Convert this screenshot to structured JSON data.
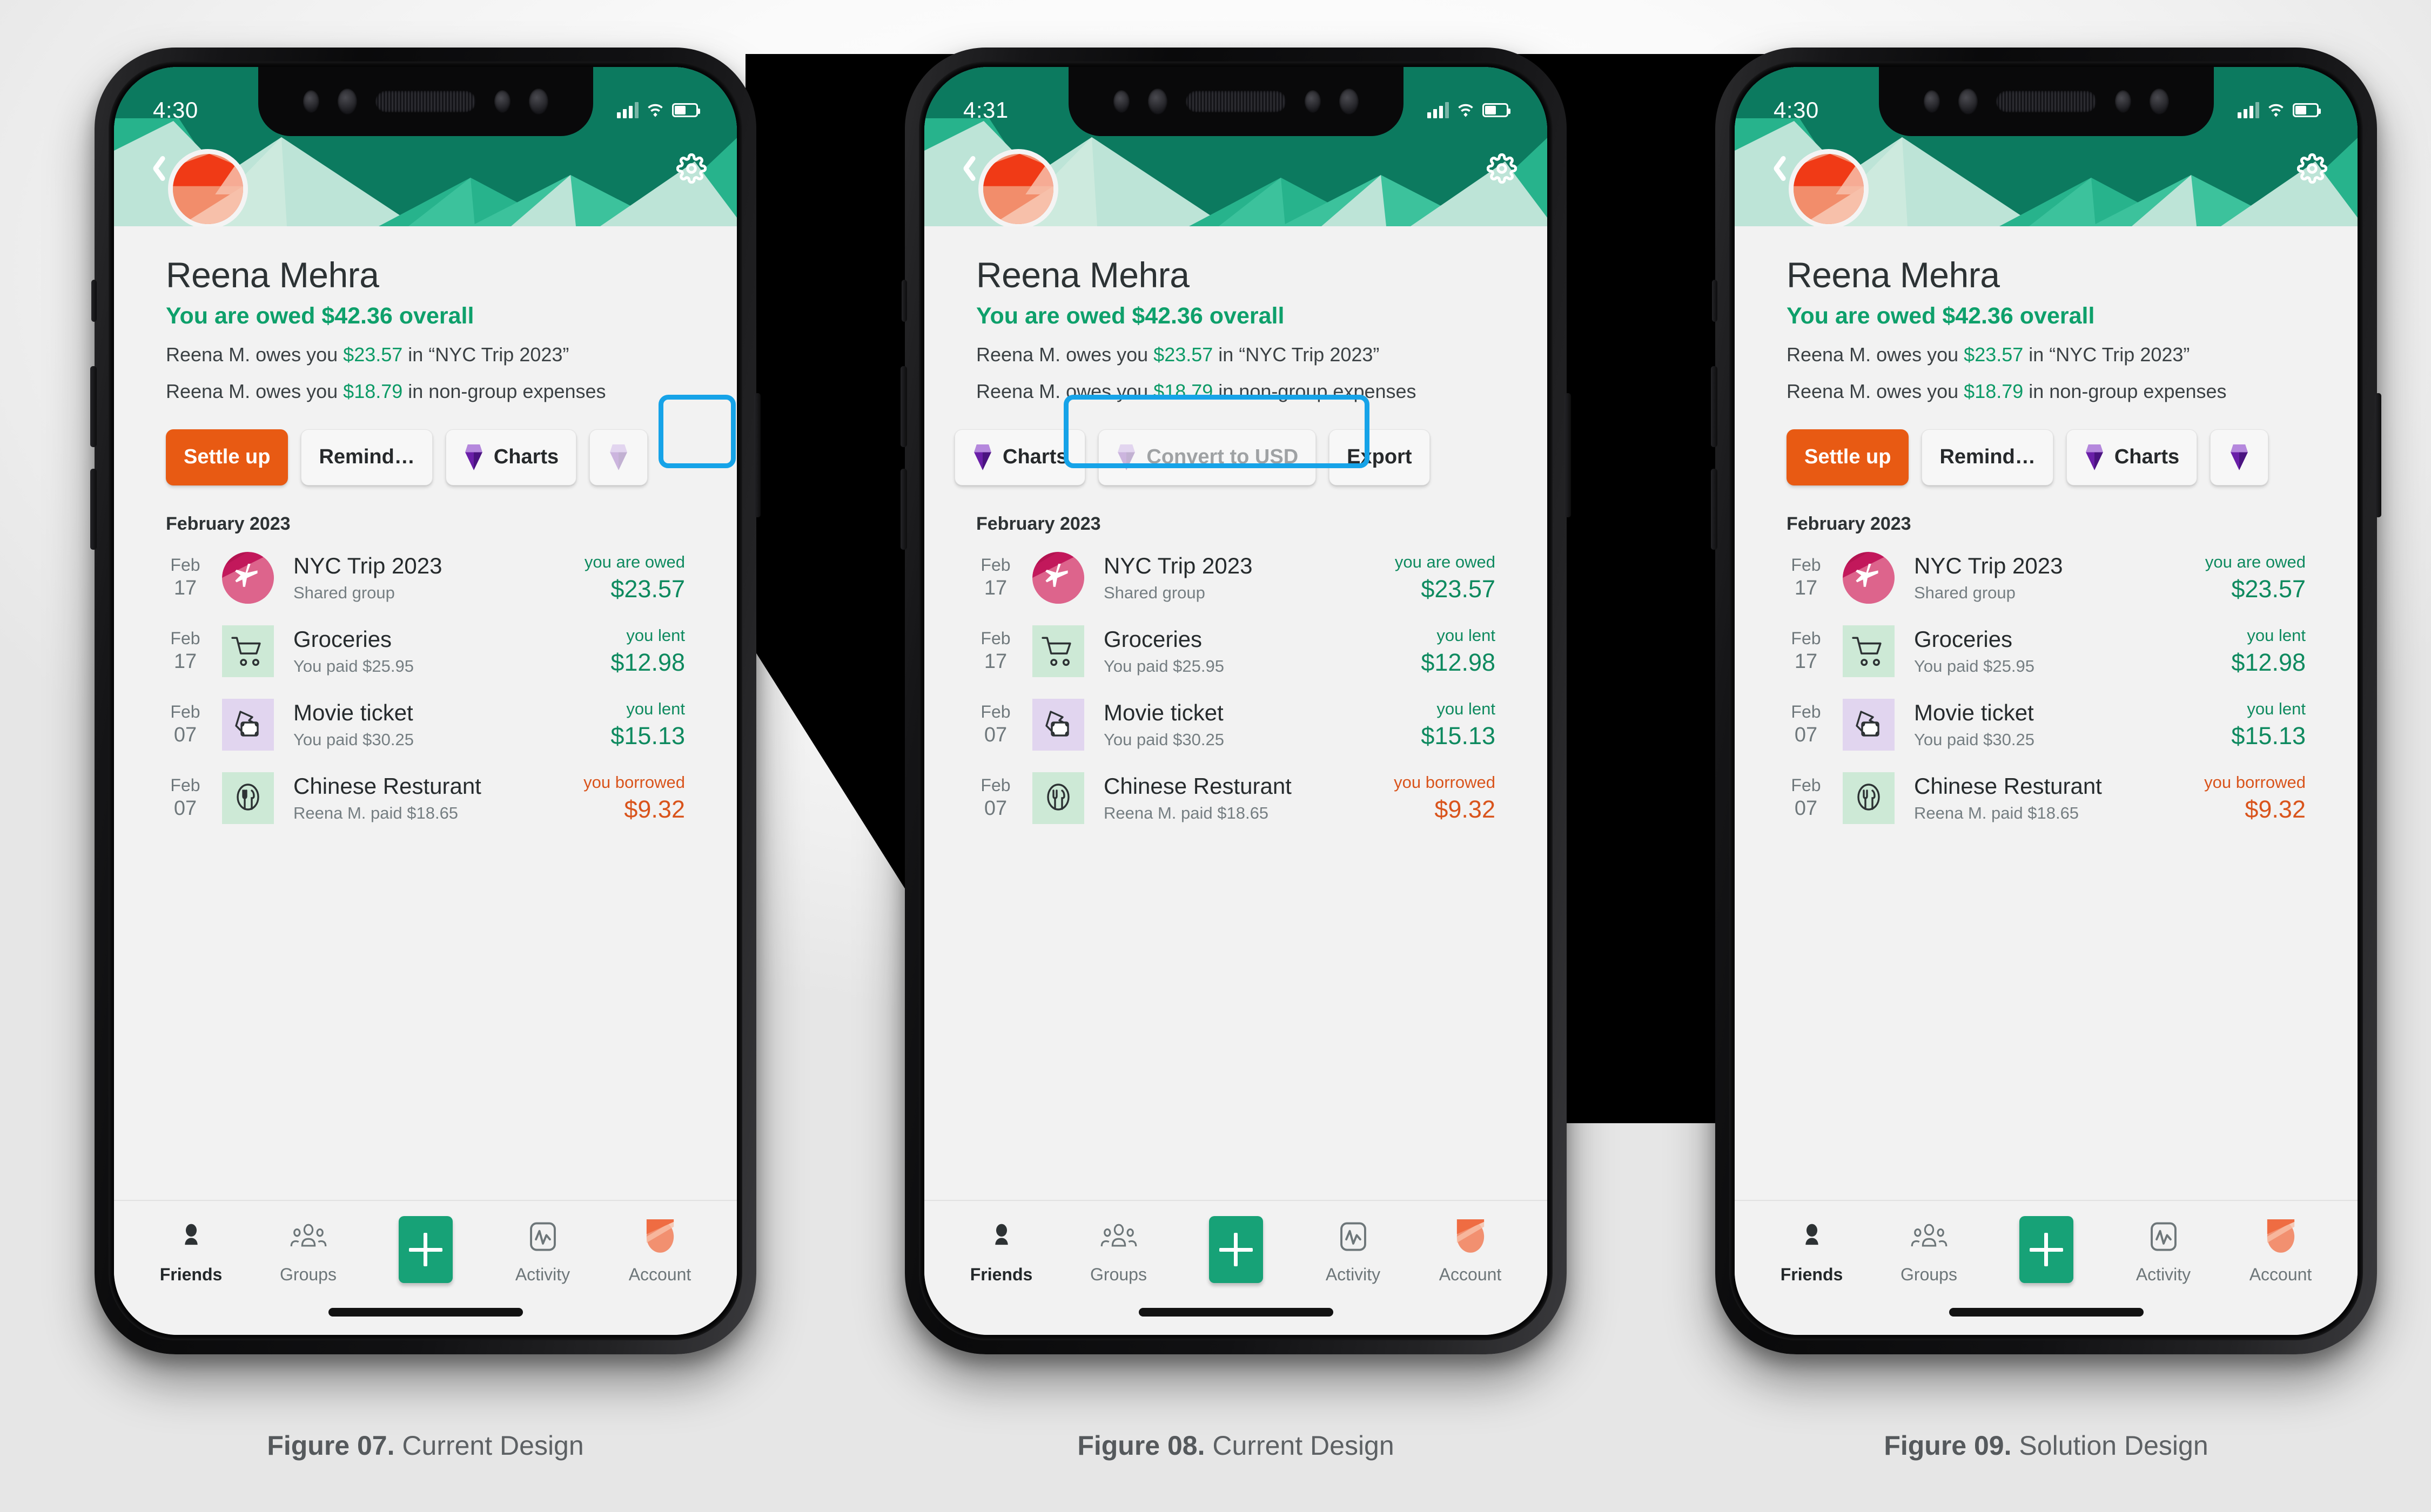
{
  "figures": [
    {
      "num": "Figure 07.",
      "label": "Current Design"
    },
    {
      "num": "Figure 08.",
      "label": "Current Design"
    },
    {
      "num": "Figure 09.",
      "label": "Solution Design"
    }
  ],
  "colors": {
    "accent_orange": "#e85a13",
    "accent_green": "#0ea06b",
    "amount_green": "#0e8a5f",
    "amount_orange": "#d9541c",
    "banner_dark": "#0c7a5f",
    "highlight_blue": "#16a3e8",
    "gem_purple": "#7b2fb5",
    "fab_green": "#17a277"
  },
  "status_bars": [
    {
      "time": "4:30",
      "signal": "cellular-signal-icon",
      "wifi": "wifi-icon",
      "battery": "battery-icon"
    },
    {
      "time": "4:31",
      "signal": "cellular-signal-icon",
      "wifi": "wifi-icon",
      "battery": "battery-icon"
    },
    {
      "time": "4:30",
      "signal": "cellular-signal-icon",
      "wifi": "wifi-icon",
      "battery": "battery-icon"
    }
  ],
  "header": {
    "back_icon": "back-chevron-icon",
    "settings_icon": "gear-icon",
    "avatar": "user-avatar"
  },
  "profile": {
    "name": "Reena Mehra",
    "summary": "You are owed $42.36 overall",
    "lines": [
      {
        "pre": "Reena M. owes you ",
        "amount": "$23.57",
        "post": " in “NYC Trip 2023”"
      },
      {
        "pre": "Reena M. owes you ",
        "amount": "$18.79",
        "post": " in non-group expenses"
      }
    ]
  },
  "actions": {
    "phone1": [
      {
        "label": "Settle up",
        "style": "primary",
        "icon": null
      },
      {
        "label": "Remind…",
        "style": "default",
        "icon": null
      },
      {
        "label": "Charts",
        "style": "default",
        "icon": "purple-gem-icon"
      },
      {
        "label": "",
        "style": "cut-off",
        "icon": "purple-gem-icon"
      }
    ],
    "phone2": [
      {
        "label": "Charts",
        "style": "default",
        "icon": "purple-gem-icon"
      },
      {
        "label": "Convert to USD",
        "style": "disabled",
        "icon": "purple-gem-icon"
      },
      {
        "label": "Export",
        "style": "default",
        "icon": null
      }
    ],
    "phone3": [
      {
        "label": "Settle up",
        "style": "primary",
        "icon": null
      },
      {
        "label": "Remind…",
        "style": "default",
        "icon": null
      },
      {
        "label": "Charts",
        "style": "default",
        "icon": "purple-gem-icon"
      },
      {
        "label": "",
        "style": "cut-off",
        "icon": "purple-gem-icon"
      }
    ]
  },
  "month_header": "February 2023",
  "expenses": [
    {
      "month": "Feb",
      "day": "17",
      "icon": "airplane-icon",
      "icon_style": "group-avatar",
      "title": "NYC Trip 2023",
      "subtitle": "Shared group",
      "status_label": "you are owed",
      "amount": "$23.57",
      "tone": "green"
    },
    {
      "month": "Feb",
      "day": "17",
      "icon": "shopping-cart-icon",
      "icon_style": "green",
      "title": "Groceries",
      "subtitle": "You paid $25.95",
      "status_label": "you lent",
      "amount": "$12.98",
      "tone": "green"
    },
    {
      "month": "Feb",
      "day": "07",
      "icon": "movie-ticket-icon",
      "icon_style": "purple",
      "title": "Movie ticket",
      "subtitle": "You paid $30.25",
      "status_label": "you lent",
      "amount": "$15.13",
      "tone": "green"
    },
    {
      "month": "Feb",
      "day": "07",
      "icon": "dining-plate-icon",
      "icon_style": "green",
      "title": "Chinese Resturant",
      "subtitle": "Reena M. paid $18.65",
      "status_label": "you borrowed",
      "amount": "$9.32",
      "tone": "orange"
    }
  ],
  "tabs": [
    {
      "label": "Friends",
      "icon": "person-icon",
      "active": true
    },
    {
      "label": "Groups",
      "icon": "people-group-icon",
      "active": false
    },
    {
      "label": "",
      "icon": "plus-icon",
      "active": false
    },
    {
      "label": "Activity",
      "icon": "activity-pulse-icon",
      "active": false
    },
    {
      "label": "Account",
      "icon": "account-avatar-icon",
      "active": false
    }
  ]
}
